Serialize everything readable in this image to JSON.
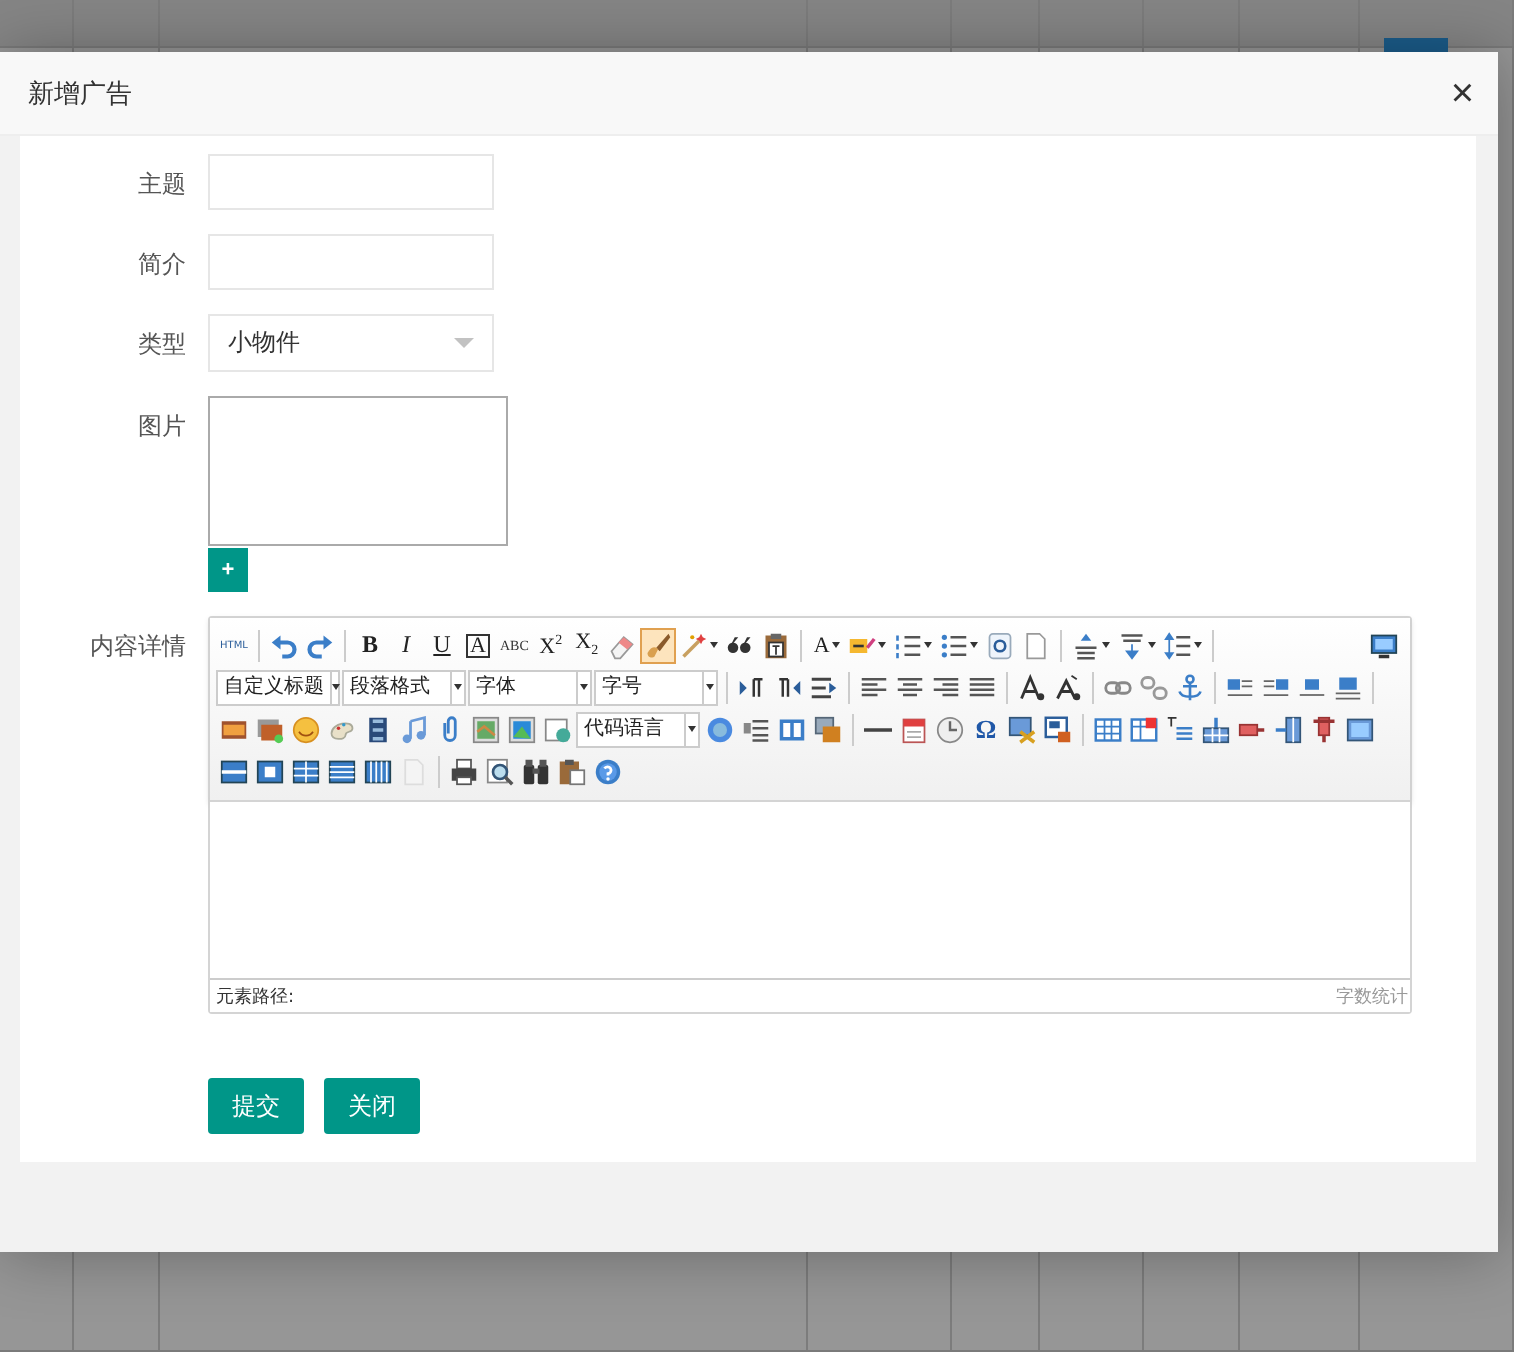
{
  "dialog": {
    "title": "新增广告",
    "close": "×"
  },
  "form": [
    {
      "kind": "text",
      "label": "主题"
    },
    {
      "kind": "text",
      "label": "简介"
    },
    {
      "kind": "select",
      "label": "类型",
      "value": "小物件"
    },
    {
      "kind": "image",
      "label": "图片",
      "button": "+"
    },
    {
      "kind": "editor",
      "label": "内容详情"
    }
  ],
  "editor": {
    "toolbar": [
      [
        {
          "kind": "glyph",
          "text": "HTML",
          "active": false,
          "menu": false
        },
        {
          "kind": "separator"
        },
        {
          "kind": "icon",
          "active": false,
          "menu": false
        },
        {
          "kind": "icon",
          "active": false,
          "menu": false
        },
        {
          "kind": "separator"
        },
        {
          "kind": "bold",
          "text": "B",
          "active": false,
          "menu": false
        },
        {
          "kind": "italic",
          "text": "I",
          "active": false,
          "menu": false
        },
        {
          "kind": "underline",
          "text": "U",
          "active": false,
          "menu": false
        },
        {
          "kind": "boxed",
          "text": "A",
          "active": false,
          "menu": false
        },
        {
          "kind": "strike",
          "text": "ABC",
          "active": false,
          "menu": false
        },
        {
          "kind": "glyph",
          "text": "X$^{2}$",
          "active": false,
          "menu": false
        },
        {
          "kind": "glyph",
          "text": "X$_{2}$",
          "active": false,
          "menu": false
        },
        {
          "kind": "icon",
          "active": false,
          "menu": false
        },
        {
          "kind": "icon",
          "active": true,
          "menu": false
        },
        {
          "kind": "icon",
          "active": false,
          "menu": true
        },
        {
          "kind": "icon",
          "active": false,
          "menu": false
        },
        {
          "kind": "icon",
          "active": false,
          "menu": false
        },
        {
          "kind": "separator"
        },
        {
          "kind": "glyph",
          "text": "A",
          "active": false,
          "menu": true
        },
        {
          "kind": "icon",
          "active": false,
          "menu": true
        },
        {
          "kind": "icon",
          "active": false,
          "menu": true
        },
        {
          "kind": "icon",
          "active": false,
          "menu": true
        },
        {
          "kind": "icon",
          "active": false,
          "menu": false
        },
        {
          "kind": "icon",
          "active": false,
          "menu": false
        },
        {
          "kind": "separator"
        },
        {
          "kind": "icon",
          "active": false,
          "menu": true
        },
        {
          "kind": "icon",
          "active": false,
          "menu": true
        },
        {
          "kind": "icon",
          "active": false,
          "menu": true
        },
        {
          "kind": "separator"
        },
        {
          "kind": "icon",
          "active": false,
          "menu": false
        }
      ],
      [
        {
          "kind": "select",
          "text": "自定义标题"
        },
        {
          "kind": "select",
          "text": "段落格式"
        },
        {
          "kind": "select",
          "text": "字体"
        },
        {
          "kind": "select",
          "text": "字号"
        },
        {
          "kind": "separator"
        },
        {
          "kind": "icon",
          "active": false,
          "menu": false
        },
        {
          "kind": "icon",
          "active": false,
          "menu": false
        },
        {
          "kind": "icon",
          "active": false,
          "menu": false
        },
        {
          "kind": "separator"
        },
        {
          "kind": "icon",
          "active": false,
          "menu": false
        },
        {
          "kind": "icon",
          "active": false,
          "menu": false
        },
        {
          "kind": "icon",
          "active": false,
          "menu": false
        },
        {
          "kind": "icon",
          "active": false,
          "menu": false
        },
        {
          "kind": "separator"
        },
        {
          "kind": "icon",
          "active": false,
          "menu": false
        },
        {
          "kind": "icon",
          "active": false,
          "menu": false
        },
        {
          "kind": "separator"
        },
        {
          "kind": "icon",
          "active": false,
          "menu": false
        },
        {
          "kind": "icon",
          "active": false,
          "menu": false
        },
        {
          "kind": "icon",
          "active": false,
          "menu": false
        },
        {
          "kind": "separator"
        },
        {
          "kind": "icon",
          "active": false,
          "menu": false
        },
        {
          "kind": "icon",
          "active": false,
          "menu": false
        },
        {
          "kind": "icon",
          "active": false,
          "menu": false
        },
        {
          "kind": "icon",
          "active": false,
          "menu": false
        },
        {
          "kind": "separator"
        }
      ],
      [
        {
          "kind": "icon",
          "active": false,
          "menu": false
        },
        {
          "kind": "icon",
          "active": false,
          "menu": false
        },
        {
          "kind": "icon",
          "active": false,
          "menu": false
        },
        {
          "kind": "icon",
          "active": false,
          "menu": false
        },
        {
          "kind": "icon",
          "active": false,
          "menu": false
        },
        {
          "kind": "icon",
          "active": false,
          "menu": false
        },
        {
          "kind": "icon",
          "active": false,
          "menu": false
        },
        {
          "kind": "icon",
          "active": false,
          "menu": false
        },
        {
          "kind": "icon",
          "active": false,
          "menu": false
        },
        {
          "kind": "icon",
          "active": false,
          "menu": false
        },
        {
          "kind": "select",
          "text": "代码语言"
        },
        {
          "kind": "icon",
          "active": false,
          "menu": false
        },
        {
          "kind": "icon",
          "active": false,
          "menu": false
        },
        {
          "kind": "icon",
          "active": false,
          "menu": false
        },
        {
          "kind": "icon",
          "active": false,
          "menu": false
        },
        {
          "kind": "separator"
        },
        {
          "kind": "icon",
          "active": false,
          "menu": false
        },
        {
          "kind": "icon",
          "active": false,
          "menu": false
        },
        {
          "kind": "icon",
          "active": false,
          "menu": false
        },
        {
          "kind": "glyph",
          "text": "Ω",
          "active": false,
          "menu": false
        },
        {
          "kind": "icon",
          "active": false,
          "menu": false
        },
        {
          "kind": "icon",
          "active": false,
          "menu": false
        },
        {
          "kind": "separator"
        },
        {
          "kind": "icon",
          "active": false,
          "menu": false
        },
        {
          "kind": "icon",
          "active": false,
          "menu": false
        },
        {
          "kind": "icon",
          "active": false,
          "menu": false
        },
        {
          "kind": "icon",
          "active": false,
          "menu": false
        },
        {
          "kind": "icon",
          "active": false,
          "menu": false
        },
        {
          "kind": "icon",
          "active": false,
          "menu": false
        },
        {
          "kind": "icon",
          "active": false,
          "menu": false
        },
        {
          "kind": "icon",
          "active": false,
          "menu": false
        }
      ],
      [
        {
          "kind": "icon",
          "active": false,
          "menu": false
        },
        {
          "kind": "icon",
          "active": false,
          "menu": false
        },
        {
          "kind": "icon",
          "active": false,
          "menu": false
        },
        {
          "kind": "icon",
          "active": false,
          "menu": false
        },
        {
          "kind": "icon",
          "active": false,
          "menu": false
        },
        {
          "kind": "icon",
          "active": false,
          "menu": false
        },
        {
          "kind": "separator"
        },
        {
          "kind": "icon",
          "active": false,
          "menu": false
        },
        {
          "kind": "icon",
          "active": false,
          "menu": false
        },
        {
          "kind": "icon",
          "active": false,
          "menu": false
        },
        {
          "kind": "icon",
          "active": false,
          "menu": false
        },
        {
          "kind": "icon",
          "active": false,
          "menu": false
        }
      ]
    ],
    "path_label": "元素路径:",
    "word_count": "字数统计"
  },
  "buttons": [
    {
      "label": "提交"
    },
    {
      "label": "关闭"
    }
  ]
}
